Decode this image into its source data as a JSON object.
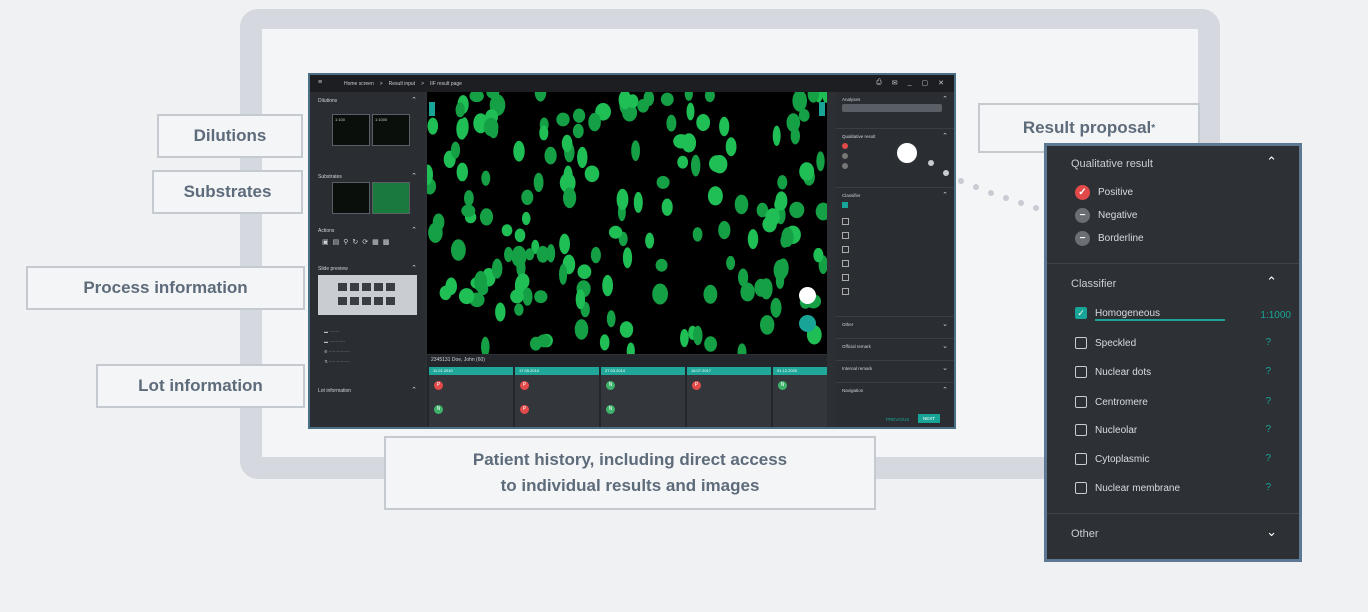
{
  "callouts": {
    "dilutions": "Dilutions",
    "substrates": "Substrates",
    "process": "Process information",
    "lot": "Lot information",
    "result_proposal": "Result proposal",
    "result_proposal_mark": "*",
    "patient_line1": "Patient history, including direct access",
    "patient_line2": "to individual results and images"
  },
  "app": {
    "breadcrumb": [
      "Home screen",
      "Result input",
      "IIF result page"
    ],
    "left": {
      "dilutions": "Dilutions",
      "substrates": "Substrates",
      "actions": "Actions",
      "slide_preview": "Slide preview",
      "lot_information": "Lot information",
      "thumb_labels": [
        "1:100",
        "1:1000"
      ]
    },
    "patient": "2345131 Doe, John (60)",
    "history_dates": [
      "11.01.2010",
      "17.05.2010",
      "27.03.2014",
      "18.07.2017",
      "01.12.2020"
    ],
    "right": {
      "analyses": "Analyses",
      "qualitative": "Qualitative result",
      "classifier": "Classifier",
      "other": "Other",
      "official_remark": "Official remark",
      "internal_remark": "Internal remark",
      "navigation": "Navigation",
      "previous": "PREVIOUS",
      "next": "NEXT"
    }
  },
  "zoom": {
    "qualitative_title": "Qualitative result",
    "qualitative_options": [
      {
        "label": "Positive",
        "state": "selected"
      },
      {
        "label": "Negative",
        "state": "off"
      },
      {
        "label": "Borderline",
        "state": "off"
      }
    ],
    "classifier_title": "Classifier",
    "classifier_items": [
      {
        "label": "Homogeneous",
        "value": "1:1000",
        "checked": true
      },
      {
        "label": "Speckled",
        "value": "?",
        "checked": false
      },
      {
        "label": "Nuclear dots",
        "value": "?",
        "checked": false
      },
      {
        "label": "Centromere",
        "value": "?",
        "checked": false
      },
      {
        "label": "Nucleolar",
        "value": "?",
        "checked": false
      },
      {
        "label": "Cytoplasmic",
        "value": "?",
        "checked": false
      },
      {
        "label": "Nuclear membrane",
        "value": "?",
        "checked": false
      }
    ],
    "other_title": "Other"
  },
  "colors": {
    "accent": "#18a597",
    "positive": "#e24a4a",
    "frame_border": "#5d7892"
  }
}
